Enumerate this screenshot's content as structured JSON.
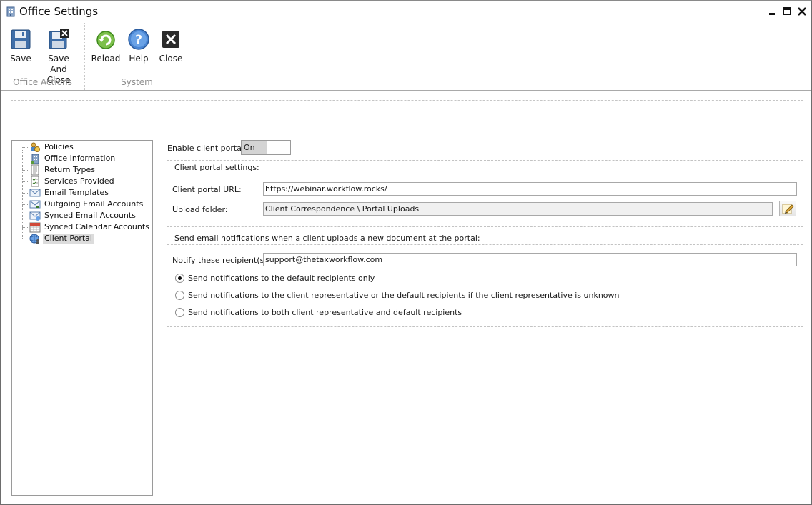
{
  "window": {
    "title": "Office Settings"
  },
  "ribbon": {
    "groups": {
      "office_actions": "Office Actions",
      "system": "System"
    },
    "buttons": {
      "save": "Save",
      "save_and_close_line1": "Save And",
      "save_and_close_line2": "Close",
      "reload": "Reload",
      "help": "Help",
      "close": "Close"
    }
  },
  "tree": {
    "items": [
      {
        "label": "Policies",
        "icon": "policies-icon"
      },
      {
        "label": "Office Information",
        "icon": "office-building-icon"
      },
      {
        "label": "Return Types",
        "icon": "document-icon"
      },
      {
        "label": "Services Provided",
        "icon": "checklist-icon"
      },
      {
        "label": "Email Templates",
        "icon": "envelope-icon"
      },
      {
        "label": "Outgoing Email Accounts",
        "icon": "envelope-outgoing-icon"
      },
      {
        "label": "Synced Email Accounts",
        "icon": "envelope-sync-icon"
      },
      {
        "label": "Synced Calendar Accounts",
        "icon": "calendar-icon"
      },
      {
        "label": "Client Portal",
        "icon": "globe-user-icon",
        "selected": true
      }
    ]
  },
  "portal": {
    "enable_label": "Enable client portal:",
    "enable_value": "On",
    "settings_title": "Client portal settings:",
    "url_label": "Client portal URL:",
    "url_value": "https://webinar.workflow.rocks/",
    "upload_label": "Upload folder:",
    "upload_value": "Client Correspondence \\ Portal Uploads"
  },
  "notifications": {
    "title": "Send email notifications when a client uploads a new document at the portal:",
    "recipients_label": "Notify these recipient(s):",
    "recipients_value": "support@thetaxworkflow.com",
    "options": [
      {
        "label": "Send notifications to the default recipients only",
        "checked": true
      },
      {
        "label": "Send notifications to the client representative or the default recipients if the client representative is unknown",
        "checked": false
      },
      {
        "label": "Send notifications to both client representative and default recipients",
        "checked": false
      }
    ]
  }
}
